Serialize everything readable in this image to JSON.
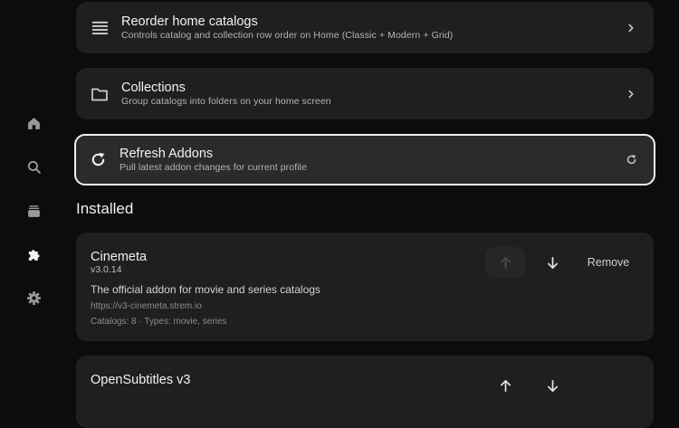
{
  "rail": {
    "items": [
      {
        "icon": "home-icon",
        "active": false
      },
      {
        "icon": "search-icon",
        "active": false
      },
      {
        "icon": "library-icon",
        "active": false
      },
      {
        "icon": "puzzle-icon",
        "active": true
      },
      {
        "icon": "gear-icon",
        "active": false
      }
    ]
  },
  "settings_rows": [
    {
      "icon": "list-icon",
      "title": "Reorder home catalogs",
      "subtitle": "Controls catalog and collection row order on Home (Classic + Modern + Grid)",
      "trail_icon": "chevron-right-icon"
    },
    {
      "icon": "folder-icon",
      "title": "Collections",
      "subtitle": "Group catalogs into folders on your home screen",
      "trail_icon": "chevron-right-icon"
    },
    {
      "icon": "refresh-icon",
      "title": "Refresh Addons",
      "subtitle": "Pull latest addon changes for current profile",
      "trail_icon": "refresh-small-icon",
      "focused": true
    }
  ],
  "installed": {
    "section_title": "Installed",
    "addons": [
      {
        "name": "Cinemeta",
        "version": "v3.0.14",
        "description": "The official addon for movie and series catalogs",
        "url": "https://v3-cinemeta.strem.io",
        "meta": "Catalogs: 8 · Types: movie, series",
        "remove_label": "Remove"
      },
      {
        "name": "OpenSubtitles v3"
      }
    ]
  },
  "colors": {
    "background": "#0c0c0c",
    "card": "#1f1f1f",
    "focused_card": "#2b2b2b",
    "focus_border": "#f1f1f1"
  }
}
